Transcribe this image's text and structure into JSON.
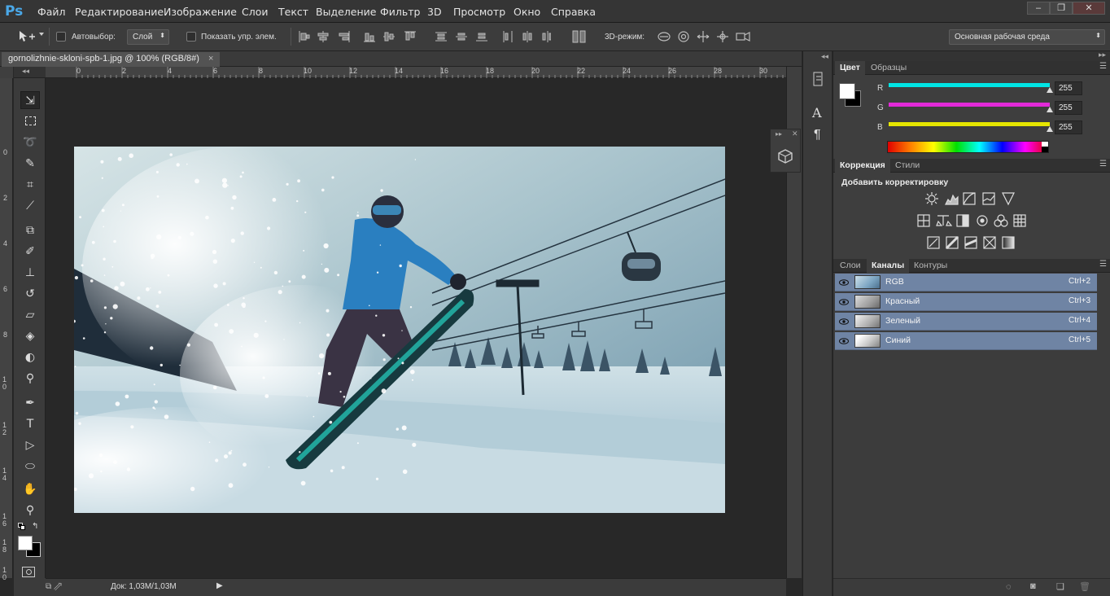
{
  "app": {
    "logo": "Ps"
  },
  "menu": [
    "Файл",
    "Редактирование",
    "Изображение",
    "Слои",
    "Текст",
    "Выделение",
    "Фильтр",
    "3D",
    "Просмотр",
    "Окно",
    "Справка"
  ],
  "window_controls": {
    "minimize": "‒",
    "restore": "❐",
    "close": "✕"
  },
  "options": {
    "autoselect_label": "Автовыбор:",
    "autoselect_target": "Слой",
    "show_transform_label": "Показать упр. элем.",
    "mode_3d_label": "3D-режим:",
    "workspace": "Основная рабочая среда"
  },
  "document": {
    "tab_title": "gornolizhnie-skloni-spb-1.jpg @ 100% (RGB/8#)",
    "close": "×"
  },
  "ruler": {
    "h_ticks": [
      "0",
      "2",
      "4",
      "6",
      "8",
      "10",
      "12",
      "14",
      "16",
      "18",
      "20",
      "22",
      "24",
      "26",
      "28",
      "30"
    ],
    "v_ticks": [
      "0",
      "2",
      "4",
      "6",
      "8",
      "10",
      "12",
      "14",
      "16",
      "18",
      "10"
    ]
  },
  "status": {
    "doc_label": "Док: 1,03M/1,03M"
  },
  "color_panel": {
    "tabs": [
      "Цвет",
      "Образцы"
    ],
    "channels": [
      {
        "label": "R",
        "value": "255",
        "color": "#00e5e5"
      },
      {
        "label": "G",
        "value": "255",
        "color": "#e22ad8"
      },
      {
        "label": "B",
        "value": "255",
        "color": "#e6e600"
      }
    ]
  },
  "adjust_panel": {
    "tabs": [
      "Коррекция",
      "Стили"
    ],
    "title": "Добавить корректировку"
  },
  "channels_panel": {
    "tabs": [
      "Слои",
      "Каналы",
      "Контуры"
    ],
    "rows": [
      {
        "name": "RGB",
        "shortcut": "Ctrl+2"
      },
      {
        "name": "Красный",
        "shortcut": "Ctrl+3"
      },
      {
        "name": "Зеленый",
        "shortcut": "Ctrl+4"
      },
      {
        "name": "Синий",
        "shortcut": "Ctrl+5"
      }
    ]
  },
  "colors": {
    "accent": "#4aa8e8",
    "selected_row": "#6f84a4"
  }
}
